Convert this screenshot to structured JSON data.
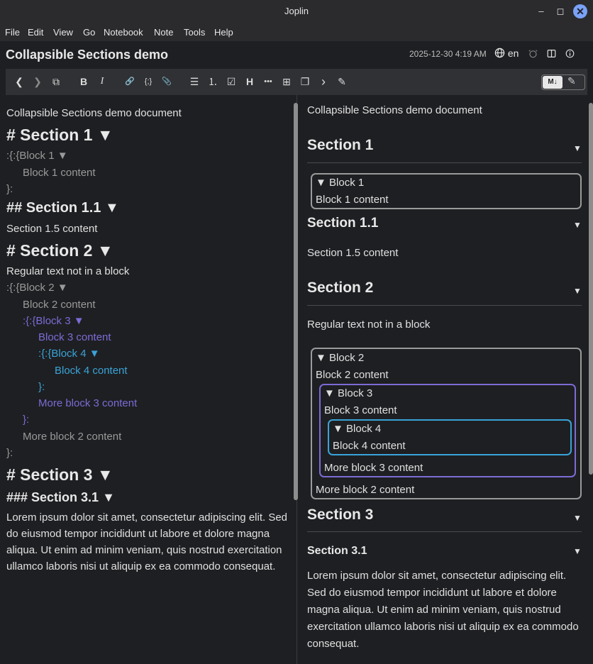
{
  "window": {
    "title": "Joplin",
    "minimize": "–",
    "maximize": "◻",
    "close": "✕"
  },
  "menu": [
    "File",
    "Edit",
    "View",
    "Go",
    "Notebook",
    "Note",
    "Tools",
    "Help"
  ],
  "note": {
    "title": "Collapsible Sections demo",
    "date": "2025-12-30 4:19 AM",
    "lang": "en"
  },
  "toolbar": {
    "back": "❮",
    "forward": "❯",
    "external": "⧉",
    "bold": "B",
    "italic": "I",
    "link": "🔗",
    "code": "{;}",
    "attach": "📎",
    "bullet": "☰",
    "numbered": "⒈",
    "checklist": "☑",
    "heading": "H",
    "more": "•••",
    "insert_time": "⊞",
    "copy": "❐",
    "next": "›",
    "spell": "✎",
    "markdown_label": "M↓",
    "editor_label": "✎"
  },
  "editor": {
    "lines": [
      "Collapsible Sections demo document",
      "# Section 1 ▼",
      ":{:{Block 1 ▼",
      "Block 1 content",
      "}:",
      "##  Section  1.1 ▼",
      "Section 1.5 content",
      "# Section 2 ▼",
      "Regular text not in a block",
      ":{:{Block 2 ▼",
      "Block 2 content",
      ":{:{Block 3 ▼",
      "Block 3 content",
      ":{:{Block 4 ▼",
      "Block 4 content",
      "}:",
      "More block 3 content",
      "}:",
      "More block 2 content",
      "}:",
      "# Section 3 ▼",
      "### Section 3.1 ▼"
    ],
    "lorem": "Lorem ipsum dolor sit amet, consectetur adipiscing elit. Sed do eiusmod tempor incididunt ut labore et dolore magna aliqua. Ut enim ad minim veniam, quis nostrud exercitation ullamco laboris nisi ut aliquip ex ea commodo consequat."
  },
  "viewer": {
    "intro": "Collapsible Sections demo document",
    "arrow": "▼",
    "section1": "Section 1",
    "block1": "▼ Block 1",
    "block1_content": "Block 1 content",
    "section11": "Section 1.1",
    "section15_content": "Section 1.5 content",
    "section2": "Section 2",
    "regular_text": "Regular text not in a block",
    "block2": "▼ Block 2",
    "block2_content": "Block 2 content",
    "block3": "▼ Block 3",
    "block3_content": "Block 3 content",
    "block4": "▼ Block 4",
    "block4_content": "Block 4 content",
    "more_block3": "More block 3 content",
    "more_block2": "More block 2 content",
    "section3": "Section 3",
    "section31": "Section 3.1",
    "lorem": "Lorem ipsum dolor sit amet, consectetur adipiscing elit. Sed do eiusmod tempor incididunt ut labore et dolore magna aliqua. Ut enim ad minim veniam, quis nostrud exercitation ullamco laboris nisi ut aliquip ex ea commodo consequat."
  }
}
